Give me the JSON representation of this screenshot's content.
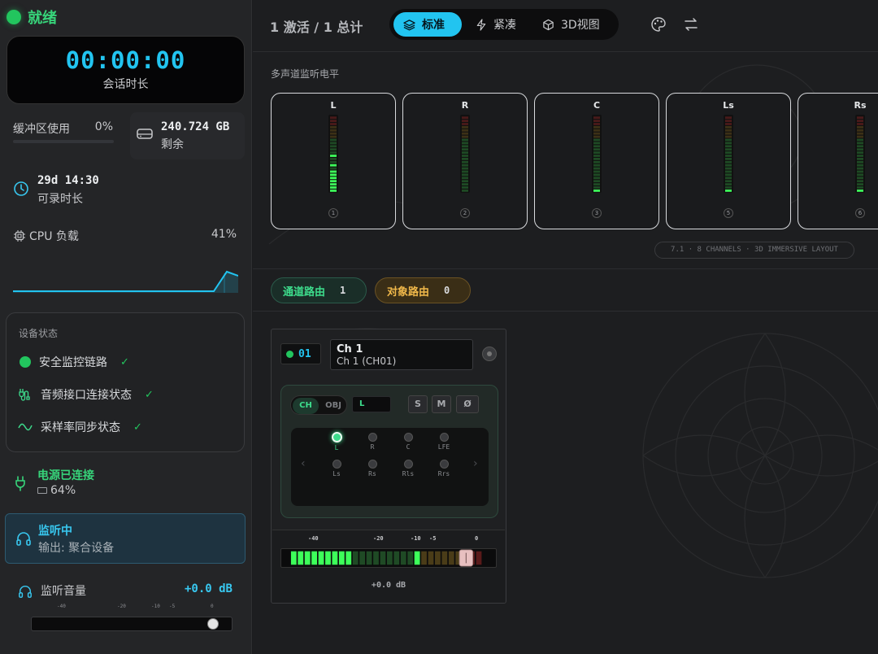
{
  "status": {
    "label": "就绪"
  },
  "timer": {
    "value": "00:00:00",
    "label": "会话时长"
  },
  "buffer": {
    "label": "缓冲区使用",
    "percent_text": "0%"
  },
  "disk": {
    "value": "240.724 GB",
    "label": "剩余",
    "icon": "hard-drive-icon"
  },
  "record_time": {
    "value": "29d 14:30",
    "label": "可录时长",
    "icon": "clock-icon"
  },
  "cpu": {
    "label": "CPU 负载",
    "percent_text": "41%",
    "icon": "chip-icon"
  },
  "device_status": {
    "title": "设备状态",
    "items": [
      {
        "label": "安全监控链路",
        "icon": "status-dot"
      },
      {
        "label": "音频接口连接状态",
        "icon": "cable-icon"
      },
      {
        "label": "采样率同步状态",
        "icon": "wave-icon"
      }
    ]
  },
  "power": {
    "title": "电源已连接",
    "battery_text": "64%",
    "icon": "plug-icon"
  },
  "monitor": {
    "title": "监听中",
    "subtitle": "输出: 聚合设备",
    "icon": "headphone-icon"
  },
  "volume": {
    "label": "监听音量",
    "db_text": "+0.0 dB",
    "scale": [
      "-40",
      "-20",
      "-10",
      "-5",
      "0"
    ],
    "icon": "headphone-icon"
  },
  "topbar": {
    "count_label": "1 激活 / 1 总计",
    "tabs": [
      {
        "label": "标准",
        "icon": "layers-icon",
        "active": true
      },
      {
        "label": "紧凑",
        "icon": "bolt-icon",
        "active": false
      },
      {
        "label": "3D视图",
        "icon": "cube-icon",
        "active": false
      }
    ],
    "palette_icon": "palette-icon",
    "swap_icon": "swap-icon"
  },
  "meters": {
    "title": "多声道监听电平",
    "channels": [
      {
        "name": "L",
        "num": "1"
      },
      {
        "name": "R",
        "num": "2"
      },
      {
        "name": "C",
        "num": "3"
      },
      {
        "name": "Ls",
        "num": "5"
      },
      {
        "name": "Rs",
        "num": "6"
      }
    ],
    "layout_badge": "7.1 · 8 CHANNELS · 3D IMMERSIVE LAYOUT"
  },
  "routing": {
    "channel_label": "通道路由",
    "channel_count": "1",
    "object_label": "对象路由",
    "object_count": "0"
  },
  "strip": {
    "id": "01",
    "name": "Ch 1",
    "subname": "Ch 1 (CH01)",
    "mode_ch": "CH",
    "mode_obj": "OBJ",
    "selected_channel": "L",
    "solo": "S",
    "mute": "M",
    "phase": "Ø",
    "pan_nodes": [
      "L",
      "R",
      "C",
      "LFE",
      "Ls",
      "Rs",
      "Rls",
      "Rrs"
    ],
    "fader_scale": [
      "-40",
      "-20",
      "-10",
      "-5",
      "0"
    ],
    "fader_db": "+0.0 dB"
  },
  "colors": {
    "accent": "#22c4f0",
    "green": "#22c55e",
    "amber": "#f0b84a"
  }
}
